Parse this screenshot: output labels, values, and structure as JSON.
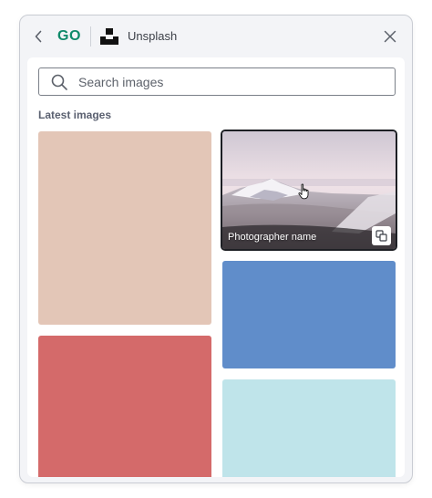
{
  "header": {
    "back_label": "",
    "logo_text": "GO",
    "app_name": "Unsplash",
    "close_label": ""
  },
  "search": {
    "placeholder": "Search images",
    "value": ""
  },
  "gallery": {
    "section_label": "Latest images",
    "featured_photo": {
      "photographer": "Photographer name",
      "action_icon": "copy-insert-icon"
    },
    "tile_colors": [
      "#e3c6b7",
      "#d46a6a",
      "#608dca",
      "#bfe4ea"
    ]
  },
  "colors": {
    "brand_green": "#0f8a6a",
    "panel_background": "#f3f4f7",
    "selected_border": "#1d1f24"
  },
  "icons": {
    "back": "chevron-left-icon",
    "app": "unsplash-icon",
    "close": "close-icon",
    "search": "search-icon",
    "pointer": "hand-pointer-icon"
  }
}
